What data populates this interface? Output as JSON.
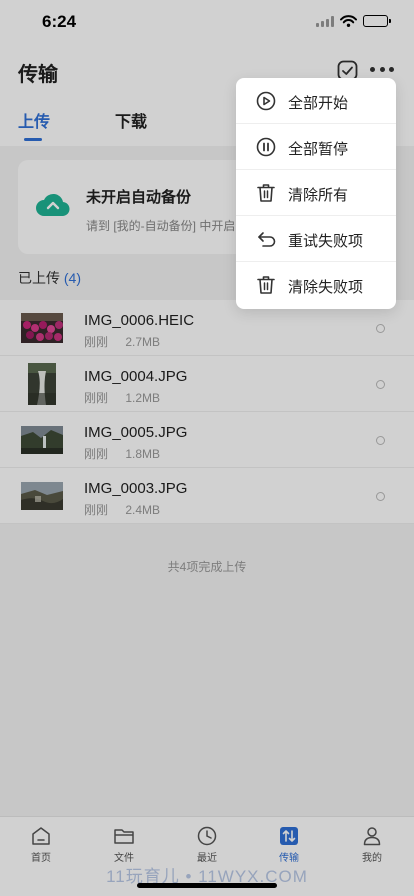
{
  "status_bar": {
    "time": "6:24"
  },
  "header": {
    "title": "传输"
  },
  "tabs": [
    {
      "label": "上传",
      "active": true
    },
    {
      "label": "下载",
      "active": false
    }
  ],
  "backup_card": {
    "title": "未开启自动备份",
    "subtitle": "请到 [我的-自动备份] 中开启"
  },
  "uploaded_section": {
    "label": "已上传",
    "count": "(4)"
  },
  "files": [
    {
      "name": "IMG_0006.HEIC",
      "time": "刚刚",
      "size": "2.7MB",
      "thumb": "flowers"
    },
    {
      "name": "IMG_0004.JPG",
      "time": "刚刚",
      "size": "1.2MB",
      "thumb": "waterfall"
    },
    {
      "name": "IMG_0005.JPG",
      "time": "刚刚",
      "size": "1.8MB",
      "thumb": "cliff"
    },
    {
      "name": "IMG_0003.JPG",
      "time": "刚刚",
      "size": "2.4MB",
      "thumb": "coast"
    }
  ],
  "complete_text": "共4项完成上传",
  "menu": {
    "items": [
      {
        "label": "全部开始",
        "icon": "play-circle-icon"
      },
      {
        "label": "全部暂停",
        "icon": "pause-circle-icon"
      },
      {
        "label": "清除所有",
        "icon": "trash-icon"
      },
      {
        "label": "重试失败项",
        "icon": "undo-icon"
      },
      {
        "label": "清除失败项",
        "icon": "trash-icon"
      }
    ]
  },
  "bottom_nav": [
    {
      "label": "首页",
      "icon": "home-icon"
    },
    {
      "label": "文件",
      "icon": "folder-icon"
    },
    {
      "label": "最近",
      "icon": "clock-icon"
    },
    {
      "label": "传输",
      "icon": "transfer-icon",
      "active": true
    },
    {
      "label": "我的",
      "icon": "person-icon"
    }
  ],
  "watermark": "11玩育儿 • 11WYX.COM",
  "colors": {
    "accent": "#2f6fd6",
    "cloud": "#1fb394",
    "overlay": "rgba(0,0,0,0.18)"
  }
}
